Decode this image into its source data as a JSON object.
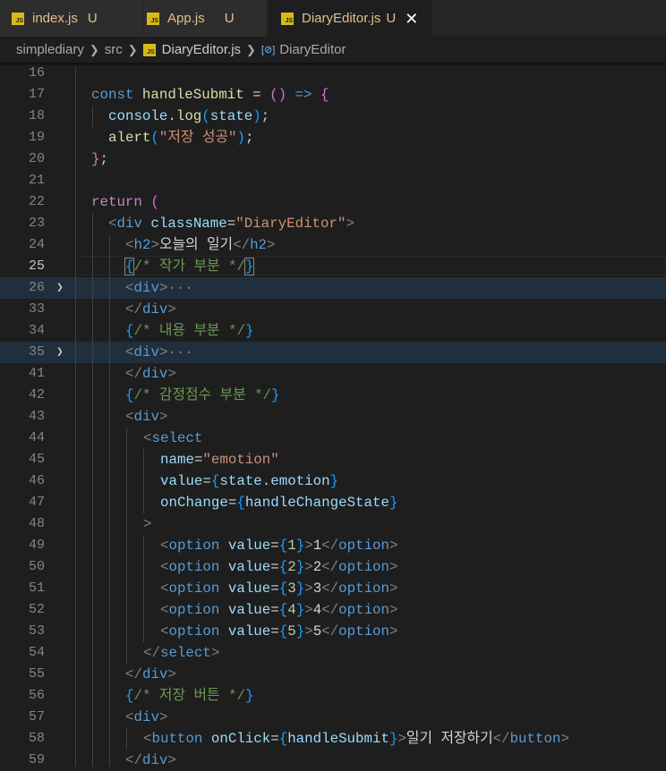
{
  "tabs": [
    {
      "name": "index.js",
      "status": "U",
      "icon": "JS"
    },
    {
      "name": "App.js",
      "status": "U",
      "icon": "JS"
    },
    {
      "name": "DiaryEditor.js",
      "status": "U",
      "icon": "JS",
      "close": "✕"
    }
  ],
  "breadcrumb": {
    "folder1": "simplediary",
    "folder2": "src",
    "file": "DiaryEditor.js",
    "symbol": "DiaryEditor",
    "symbol_icon": "[⊘]"
  },
  "code": {
    "line_numbers": [
      "16",
      "17",
      "18",
      "19",
      "20",
      "21",
      "22",
      "23",
      "24",
      "25",
      "26",
      "33",
      "34",
      "35",
      "41",
      "42",
      "43",
      "44",
      "45",
      "46",
      "47",
      "48",
      "49",
      "50",
      "51",
      "52",
      "53",
      "54",
      "55",
      "56",
      "57",
      "58",
      "59"
    ],
    "l17": {
      "const": "const",
      "name": "handleSubmit",
      "eq": " = ",
      "paren": "()",
      "arrow": " => ",
      "brace": "{"
    },
    "l18": {
      "obj": "console",
      "dot": ".",
      "method": "log",
      "open": "(",
      "arg": "state",
      "close": ")",
      "semi": ";"
    },
    "l19": {
      "fn": "alert",
      "open": "(",
      "str": "\"저장 성공\"",
      "close": ")",
      "semi": ";"
    },
    "l20": {
      "brace": "}",
      "semi": ";"
    },
    "l22": {
      "kw": "return",
      "open": " ("
    },
    "l23": {
      "tag": "div",
      "attr": "className",
      "val": "\"DiaryEditor\""
    },
    "l24": {
      "tag": "h2",
      "text": "오늘의 일기"
    },
    "l25": {
      "comment": "/* 작가 부분 */"
    },
    "l26": {
      "tag": "div",
      "ellipsis": "···"
    },
    "l33": {
      "tag": "div"
    },
    "l34": {
      "comment": "/* 내용 부분 */"
    },
    "l35": {
      "tag": "div",
      "ellipsis": "···"
    },
    "l41": {
      "tag": "div"
    },
    "l42": {
      "comment": "/* 감정점수 부분 */"
    },
    "l43": {
      "tag": "div"
    },
    "l44": {
      "tag": "select"
    },
    "l45": {
      "attr": "name",
      "val": "\"emotion\""
    },
    "l46": {
      "attr": "value",
      "obj": "state",
      "prop": "emotion"
    },
    "l47": {
      "attr": "onChange",
      "fn": "handleChangeState"
    },
    "options": [
      {
        "value": "1",
        "label": "1"
      },
      {
        "value": "2",
        "label": "2"
      },
      {
        "value": "3",
        "label": "3"
      },
      {
        "value": "4",
        "label": "4"
      },
      {
        "value": "5",
        "label": "5"
      }
    ],
    "option_tag": "option",
    "option_attr": "value",
    "l54": {
      "tag": "select"
    },
    "l55": {
      "tag": "div"
    },
    "l56": {
      "comment": "/* 저장 버튼 */"
    },
    "l57": {
      "tag": "div"
    },
    "l58": {
      "tag": "button",
      "attr": "onClick",
      "fn": "handleSubmit",
      "text": "일기 저장하기"
    },
    "l59": {
      "tag": "div"
    }
  },
  "colors": {
    "background": "#1e1e1e",
    "keyword": "#569cd6",
    "string": "#ce9178",
    "comment": "#6a9955",
    "function": "#dcdcaa",
    "variable": "#9cdcfe",
    "modified": "#e2c08d"
  }
}
